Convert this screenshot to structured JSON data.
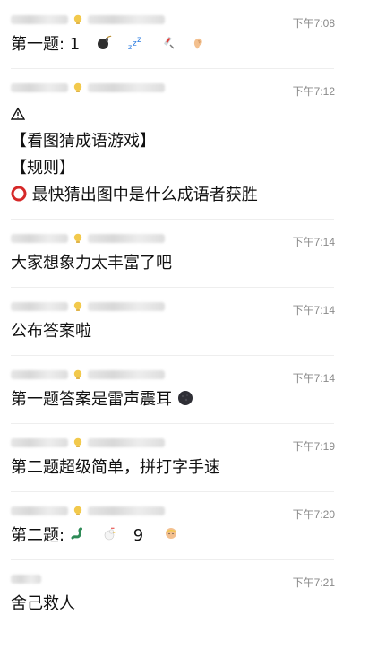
{
  "messages": [
    {
      "time": "下午7:08",
      "text": "第一题: 1",
      "emoji_icons": [
        "bomb-icon",
        "zzz-icon",
        "syringe-icon",
        "ear-icon"
      ]
    },
    {
      "time": "下午7:12",
      "lines": [
        "【看图猜成语游戏】",
        "【规则】",
        "最快猜出图中是什么成语者获胜"
      ],
      "icons": [
        "warning-icon",
        "red-circle-icon"
      ]
    },
    {
      "time": "下午7:14",
      "text": "大家想象力太丰富了吧"
    },
    {
      "time": "下午7:14",
      "text": "公布答案啦"
    },
    {
      "time": "下午7:14",
      "text": "第一题答案是雷声震耳",
      "emoji_icons": [
        "new-moon-icon"
      ]
    },
    {
      "time": "下午7:19",
      "text": "第二题超级简单，拼打字手速"
    },
    {
      "time": "下午7:20",
      "text_prefix": "第二题:",
      "text_number": "9",
      "emoji_icons": [
        "snake-icon",
        "rooster-icon",
        "person-icon"
      ]
    },
    {
      "time": "下午7:21",
      "text": "舍己救人"
    }
  ],
  "colors": {
    "time": "#8a8a8a",
    "divider": "#eeeeee",
    "text": "#111111",
    "bulb": "#f2c94c"
  }
}
